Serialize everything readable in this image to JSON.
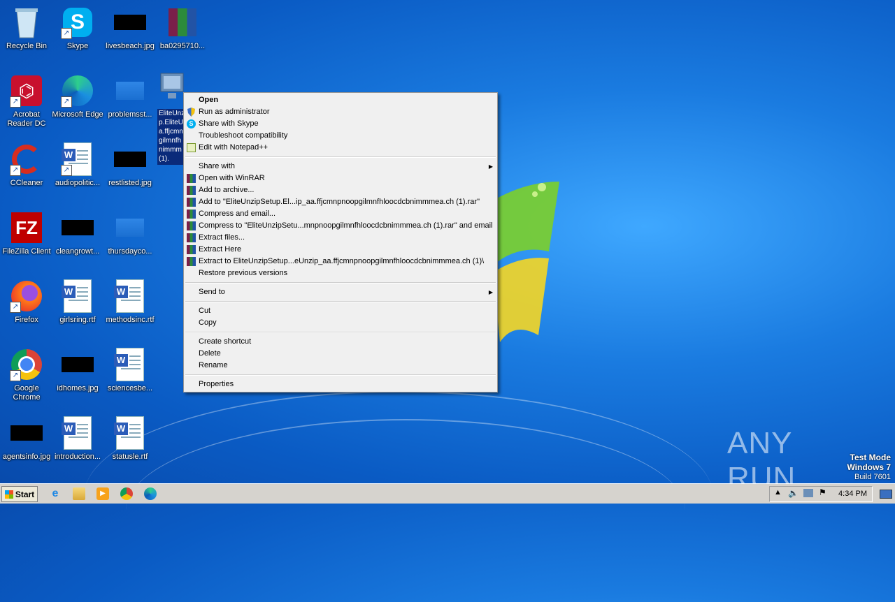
{
  "desktop": {
    "icons": [
      {
        "label": "Recycle Bin",
        "icon": "recycle-bin-icon"
      },
      {
        "label": "Skype",
        "icon": "skype-icon"
      },
      {
        "label": "livesbeach.jpg",
        "icon": "image-file-icon"
      },
      {
        "label": "ba0295710...",
        "icon": "winrar-archive-icon"
      },
      {
        "label": "Acrobat Reader DC",
        "icon": "acrobat-icon"
      },
      {
        "label": "Microsoft Edge",
        "icon": "edge-icon"
      },
      {
        "label": "problemsst...",
        "icon": "file-icon"
      },
      {
        "label": "CCleaner",
        "icon": "ccleaner-icon"
      },
      {
        "label": "audiopolitic...",
        "icon": "word-doc-icon"
      },
      {
        "label": "restlisted.jpg",
        "icon": "image-file-icon"
      },
      {
        "label": "FileZilla Client",
        "icon": "filezilla-icon"
      },
      {
        "label": "cleangrowt...",
        "icon": "image-file-icon"
      },
      {
        "label": "thursdayco...",
        "icon": "file-icon"
      },
      {
        "label": "Firefox",
        "icon": "firefox-icon"
      },
      {
        "label": "girlsring.rtf",
        "icon": "word-doc-icon"
      },
      {
        "label": "methodsinc.rtf",
        "icon": "word-doc-icon"
      },
      {
        "label": "Google Chrome",
        "icon": "chrome-icon"
      },
      {
        "label": "idhomes.jpg",
        "icon": "image-file-icon"
      },
      {
        "label": "sciencesbe...",
        "icon": "word-doc-icon"
      },
      {
        "label": "agentsinfo.jpg",
        "icon": "image-file-icon"
      },
      {
        "label": "introduction...",
        "icon": "word-doc-icon"
      },
      {
        "label": "statusle.rtf",
        "icon": "word-doc-icon"
      }
    ],
    "selected_file_label": "EliteUnzi p.EliteU a.ffjcmn gilmnfh nimmm (1)."
  },
  "context_menu": {
    "open": "Open",
    "run_as_admin": "Run as administrator",
    "share_skype": "Share with Skype",
    "troubleshoot": "Troubleshoot compatibility",
    "edit_notepad": "Edit with Notepad++",
    "share_with": "Share with",
    "open_winrar": "Open with WinRAR",
    "add_archive": "Add to archive...",
    "add_to_rar": "Add to \"EliteUnzipSetup.El...ip_aa.ffjcmnpnoopgilmnfhloocdcbnimmmea.ch (1).rar\"",
    "compress_email": "Compress and email...",
    "compress_to_email": "Compress to \"EliteUnzipSetu...mnpnoopgilmnfhloocdcbnimmmea.ch (1).rar\" and email",
    "extract_files": "Extract files...",
    "extract_here": "Extract Here",
    "extract_to": "Extract to EliteUnzipSetup...eUnzip_aa.ffjcmnpnoopgilmnfhloocdcbnimmmea.ch (1)\\",
    "restore_versions": "Restore previous versions",
    "send_to": "Send to",
    "cut": "Cut",
    "copy": "Copy",
    "create_shortcut": "Create shortcut",
    "delete": "Delete",
    "rename": "Rename",
    "properties": "Properties"
  },
  "taskbar": {
    "start_label": "Start",
    "clock": "4:34 PM"
  },
  "watermark": {
    "line1": "Test Mode",
    "line2": "Windows 7",
    "line3": "Build 7601",
    "brand": "ANY RUN"
  },
  "colors": {
    "desktop_blue": "#1a7be0",
    "menu_bg": "#f0f0f0",
    "taskbar_bg": "#d6d3ce",
    "selection": "#0a2a7a"
  }
}
